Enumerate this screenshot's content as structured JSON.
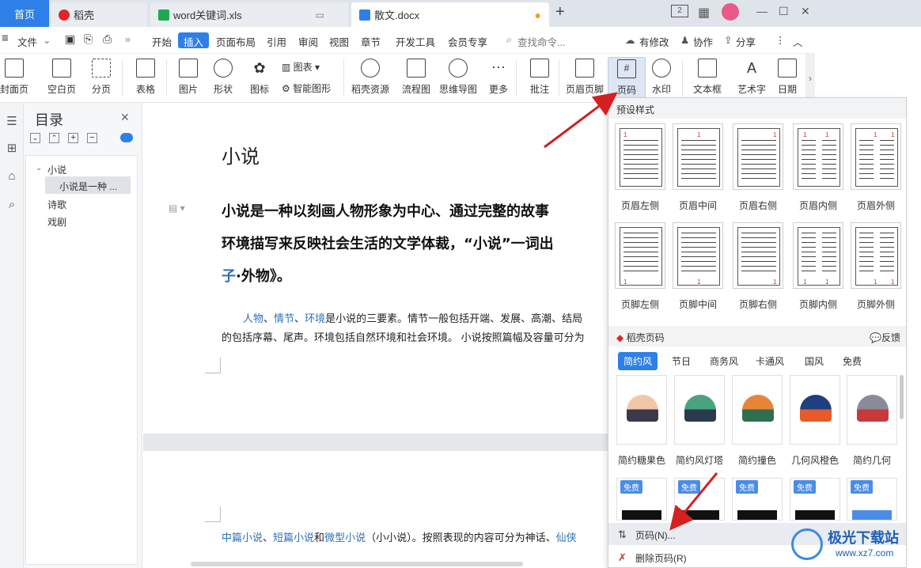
{
  "tabs": {
    "home": "首页",
    "daoke": "稻壳",
    "xls": "word关键词.xls",
    "doc": "散文.docx",
    "add": "+"
  },
  "window": {
    "layout_num": "2"
  },
  "menu": {
    "hamburger": "≡",
    "file": "文件",
    "items": [
      "开始",
      "插入",
      "页面布局",
      "引用",
      "审阅",
      "视图",
      "章节",
      "开发工具",
      "会员专享"
    ],
    "search": "查找命令...",
    "modified": "有修改",
    "collab": "协作",
    "share": "分享"
  },
  "ribbon": {
    "buttons": [
      "封面页",
      "空白页",
      "分页",
      "表格",
      "图片",
      "形状",
      "图标",
      "图表",
      "智能图形",
      "稻壳资源",
      "流程图",
      "思维导图",
      "更多",
      "批注",
      "页眉页脚",
      "页码",
      "水印",
      "文本框",
      "艺术字",
      "日期"
    ]
  },
  "toc": {
    "title": "目录",
    "items": [
      "小说",
      "小说是一种 ...",
      "诗歌",
      "戏剧"
    ]
  },
  "doc": {
    "title": "小说",
    "bold1": "小说是一种以刻画人物形象为中心、通过完整的故事",
    "bold2": "环境描写来反映社会生活的文学体裁，“小说”一词出",
    "bold3_link": "子",
    "bold3": "·外物》。",
    "p1_links": [
      "人物",
      "情节",
      "环境"
    ],
    "p1_sep": "、",
    "p1_rest": "是小说的三要素。情节一般包括开端、发展、高潮、结局",
    "p2": "的包括序幕、尾声。环境包括自然环境和社会环境。 小说按照篇幅及容量可分为",
    "p3_links": [
      "中篇小说",
      "短篇小说",
      "微型小说",
      "仙侠"
    ],
    "p3_and": "和",
    "p3_rest": "（小小说）。按照表现的内容可分为神话、"
  },
  "popup": {
    "preset_header": "预设样式",
    "header_labels": [
      "页眉左侧",
      "页眉中间",
      "页眉右侧",
      "页眉内侧",
      "页眉外侧"
    ],
    "footer_labels": [
      "页脚左侧",
      "页脚中间",
      "页脚右侧",
      "页脚内侧",
      "页脚外侧"
    ],
    "thumb_num": "1",
    "daoke_title": "稻壳页码",
    "feedback": "反馈",
    "categories": [
      "简约风",
      "节日",
      "商务风",
      "卡通风",
      "国风",
      "免费"
    ],
    "cards": [
      "简约糖果色",
      "简约风灯塔",
      "简约撞色",
      "几何风橙色",
      "简约几何"
    ],
    "free_badge": "免费",
    "action_pagenum": "页码(N)...",
    "action_delete": "删除页码(R)"
  },
  "watermark": {
    "brand": "极光下载站",
    "url": "www.xz7.com"
  },
  "colors": {
    "accent": "#2f7fe8",
    "arrow": "#d42020",
    "link": "#2d6fb8"
  }
}
